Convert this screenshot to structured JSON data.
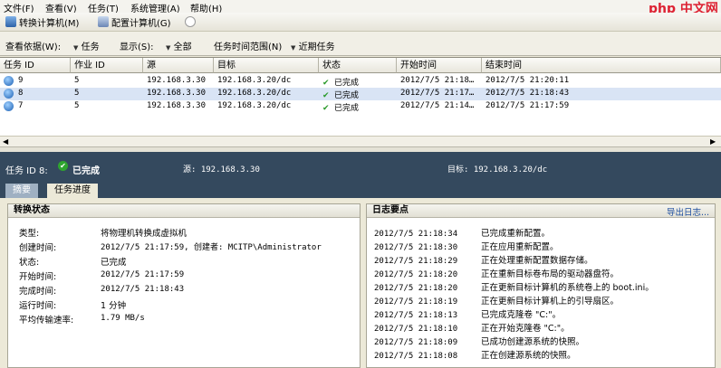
{
  "menu": [
    "文件(F)",
    "查看(V)",
    "任务(T)",
    "系统管理(A)",
    "帮助(H)"
  ],
  "watermark": "php 中文网",
  "toolbar": {
    "convert_label": "转换计算机(M)",
    "configure_label": "配置计算机(G)"
  },
  "filters": {
    "view_by_label": "查看依据(W):",
    "view_by_value": "任务",
    "show_label": "显示(S):",
    "show_value": "全部",
    "time_range_label": "任务时间范围(N)",
    "time_range_value": "近期任务"
  },
  "table": {
    "headers": [
      "任务 ID",
      "作业 ID",
      "源",
      "目标",
      "状态",
      "开始时间",
      "结束时间"
    ],
    "rows": [
      {
        "task_id": "9",
        "job_id": "5",
        "source": "192.168.3.30",
        "target": "192.168.3.20/dc",
        "status": "已完成",
        "start": "2012/7/5 21:18…",
        "end": "2012/7/5 21:20:11",
        "selected": false
      },
      {
        "task_id": "8",
        "job_id": "5",
        "source": "192.168.3.30",
        "target": "192.168.3.20/dc",
        "status": "已完成",
        "start": "2012/7/5 21:17…",
        "end": "2012/7/5 21:18:43",
        "selected": true
      },
      {
        "task_id": "7",
        "job_id": "5",
        "source": "192.168.3.30",
        "target": "192.168.3.20/dc",
        "status": "已完成",
        "start": "2012/7/5 21:14…",
        "end": "2012/7/5 21:17:59",
        "selected": false
      }
    ]
  },
  "detail": {
    "task_label": "任务 ID 8:",
    "status": "已完成",
    "source": "源: 192.168.3.30",
    "target": "目标: 192.168.3.20/dc",
    "tabs": [
      "摘要",
      "任务进度"
    ],
    "conversion_title": "转换状态",
    "fields": [
      {
        "k": "类型:",
        "v": "将物理机转换成虚拟机"
      },
      {
        "k": "创建时间:",
        "v": "2012/7/5 21:17:59, 创建者: MCITP\\Administrator"
      },
      {
        "k": "状态:",
        "v": "已完成"
      },
      {
        "k": "开始时间:",
        "v": "2012/7/5 21:17:59"
      },
      {
        "k": "完成时间:",
        "v": "2012/7/5 21:18:43"
      },
      {
        "k": "运行时间:",
        "v": "1 分钟"
      },
      {
        "k": "平均传输速率:",
        "v": "1.79 MB/s"
      }
    ],
    "log_title": "日志要点",
    "export_label": "导出日志...",
    "log": [
      {
        "t": "2012/7/5 21:18:34",
        "m": "已完成重新配置。"
      },
      {
        "t": "2012/7/5 21:18:30",
        "m": "正在应用重新配置。"
      },
      {
        "t": "2012/7/5 21:18:29",
        "m": "正在处理重新配置数据存储。"
      },
      {
        "t": "2012/7/5 21:18:20",
        "m": "正在重新目标卷布局的驱动器盘符。"
      },
      {
        "t": "2012/7/5 21:18:20",
        "m": "正在更新目标计算机的系统卷上的 boot.ini。"
      },
      {
        "t": "2012/7/5 21:18:19",
        "m": "正在更新目标计算机上的引导扇区。"
      },
      {
        "t": "2012/7/5 21:18:13",
        "m": "已完成克隆卷 \"C:\"。"
      },
      {
        "t": "2012/7/5 21:18:10",
        "m": "正在开始克隆卷 \"C:\"。"
      },
      {
        "t": "2012/7/5 21:18:09",
        "m": "已成功创建源系统的快照。"
      },
      {
        "t": "2012/7/5 21:18:08",
        "m": "正在创建源系统的快照。"
      }
    ]
  }
}
